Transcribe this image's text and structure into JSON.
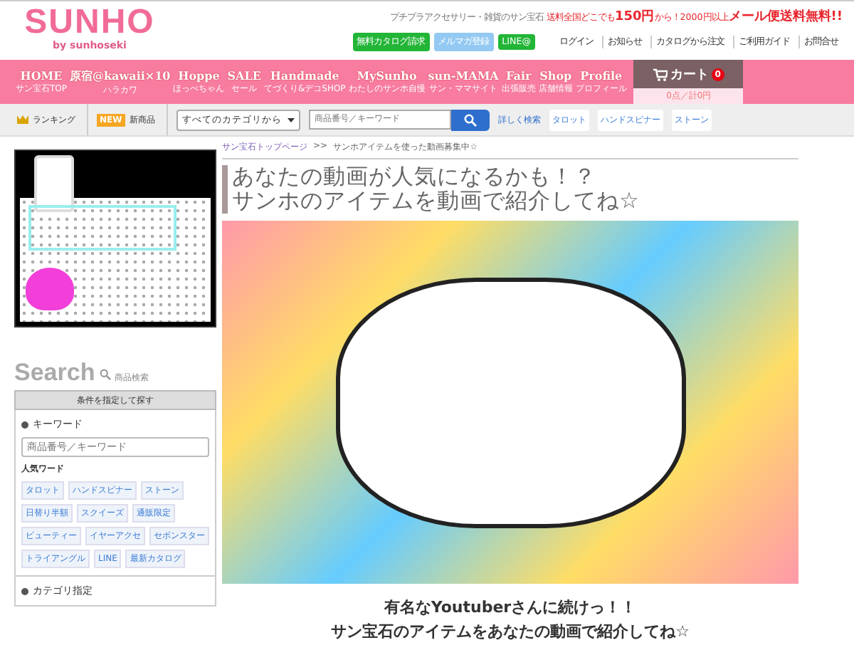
{
  "header": {
    "logo": "SUNHO",
    "logo_sub": "by sunhoseki",
    "tagline": "プチプラアクセサリー・雑貨のサン宝石",
    "shipping": "送料全国どこでも**150円**から！2000円以上**メール便送料無料!!**",
    "buttons": [
      {
        "label": "無料カタログ請求",
        "kind": "green"
      },
      {
        "label": "メルマガ登録",
        "kind": "blue"
      },
      {
        "label": "LINE@",
        "kind": "green"
      }
    ],
    "links": [
      "ログイン",
      "お知らせ",
      "カタログから注文",
      "ご利用ガイド",
      "お問合せ"
    ]
  },
  "nav": {
    "items": [
      {
        "label": "HOME",
        "sub": "サン宝石TOP"
      },
      {
        "label": "原宿@kawaii×10",
        "sub": "ハラカワ"
      },
      {
        "label": "Hoppe",
        "sub": "ほっぺちゃん"
      },
      {
        "label": "SALE",
        "sub": "セール"
      },
      {
        "label": "Handmade",
        "sub": "てづくり&デコSHOP"
      },
      {
        "label": "MySunho",
        "sub": "わたしのサンホ自慢"
      },
      {
        "label": "sun-MAMA",
        "sub": "サン・ママサイト"
      },
      {
        "label": "Fair",
        "sub": "出張販売"
      },
      {
        "label": "Shop",
        "sub": "店舗情報"
      },
      {
        "label": "Profile",
        "sub": "プロフィール"
      }
    ],
    "cart": {
      "label": "カート",
      "count": "0",
      "summary": "0点／計0円"
    }
  },
  "toolbar": {
    "ranking": "ランキング",
    "new_badge": "NEW",
    "new_label": "新商品",
    "category": "すべてのカテゴリから",
    "search_placeholder": "商品番号／キーワード",
    "advanced": "詳しく検索",
    "tags": [
      "タロット",
      "ハンドスピナー",
      "ストーン"
    ]
  },
  "sidebar": {
    "search_title": "Search",
    "search_sub": "商品検索",
    "condition_button": "条件を指定して探す",
    "keyword_heading": "キーワード",
    "keyword_placeholder": "商品番号／キーワード",
    "popular_label": "人気ワード",
    "popular_tags": [
      "タロット",
      "ハンドスピナー",
      "ストーン",
      "日替り半額",
      "スクイーズ",
      "通販限定",
      "ビューティー",
      "イヤーアクセ",
      "セボンスター",
      "トライアングル",
      "LINE",
      "最新カタログ"
    ],
    "category_heading": "カテゴリ指定"
  },
  "breadcrumb": [
    {
      "label": "サン宝石トップページ",
      "kind": "link"
    },
    {
      "label": ">>",
      "kind": "separator"
    },
    {
      "label": "サンホアイテムを使った動画募集中☆",
      "kind": "current"
    }
  ],
  "main": {
    "title_lines": [
      "あなたの動画が人気になるかも！？",
      "サンホのアイテムを動画で紹介してね☆"
    ],
    "lead_lines": [
      "有名なYoutuberさんに続けっ！！",
      "サン宝石のアイテムをあなたの動画で紹介してね☆"
    ]
  }
}
